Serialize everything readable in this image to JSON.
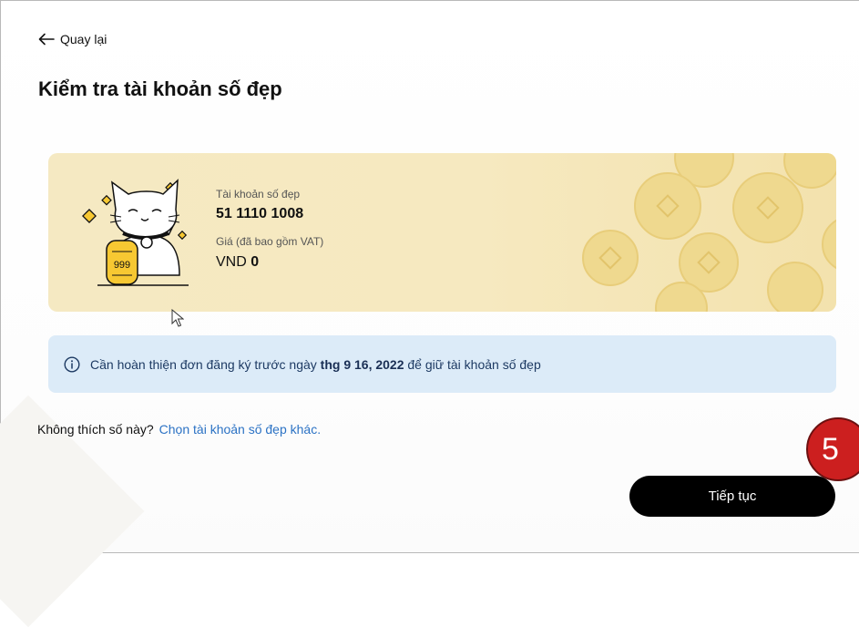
{
  "header": {
    "back_label": "Quay lại",
    "title": "Kiểm tra tài khoản số đẹp"
  },
  "account_card": {
    "account_label": "Tài khoản số đẹp",
    "account_number": "51 1110 1008",
    "price_label": "Giá (đã bao gồm VAT)",
    "price_currency": "VND",
    "price_value": "0",
    "illustration_text": "999"
  },
  "notice": {
    "text_before": "Cần hoàn thiện đơn đăng ký trước ngày",
    "deadline": "thg 9 16, 2022",
    "text_after": "để giữ tài khoản số đẹp"
  },
  "alternative": {
    "question": "Không thích số này?",
    "link_label": "Chọn tài khoản số đẹp khác."
  },
  "actions": {
    "continue_label": "Tiếp tục"
  },
  "annotation": {
    "step_number": "5"
  },
  "colors": {
    "card_background": "#f5e9c2",
    "coin": "#efd98f",
    "notice_background": "#dcebf8",
    "link": "#2b72c4",
    "primary_button": "#000000",
    "step_badge": "#cc1f1f"
  }
}
